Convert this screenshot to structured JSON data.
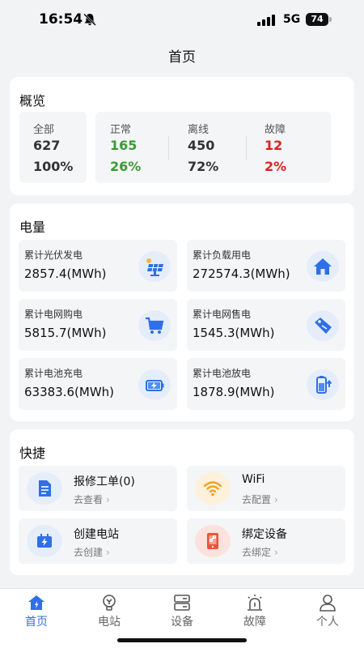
{
  "status_bar": {
    "time": "16:54",
    "network": "5G",
    "battery": "74"
  },
  "page": {
    "title": "首页"
  },
  "overview": {
    "title": "概览",
    "all": {
      "label": "全部",
      "count": "627",
      "percent": "100%"
    },
    "normal": {
      "label": "正常",
      "count": "165",
      "percent": "26%",
      "color": "#3a9a35"
    },
    "offline": {
      "label": "离线",
      "count": "450",
      "percent": "72%",
      "color": "#333333"
    },
    "fault": {
      "label": "故障",
      "count": "12",
      "percent": "2%",
      "color": "#e02020"
    }
  },
  "energy": {
    "title": "电量",
    "items": [
      {
        "label": "累计光伏发电",
        "value": "2857.4(MWh)",
        "icon": "solar-panel-icon"
      },
      {
        "label": "累计负载用电",
        "value": "272574.3(MWh)",
        "icon": "home-icon"
      },
      {
        "label": "累计电网购电",
        "value": "5815.7(MWh)",
        "icon": "cart-icon"
      },
      {
        "label": "累计电网售电",
        "value": "1545.3(MWh)",
        "icon": "price-tag-icon"
      },
      {
        "label": "累计电池充电",
        "value": "63383.6(MWh)",
        "icon": "battery-charge-icon"
      },
      {
        "label": "累计电池放电",
        "value": "1878.9(MWh)",
        "icon": "battery-discharge-icon"
      }
    ]
  },
  "quick": {
    "title": "快捷",
    "items": [
      {
        "label": "报修工单(0)",
        "action": "去查看",
        "icon": "document-icon",
        "color": "#2f6fe8"
      },
      {
        "label": "WiFi",
        "action": "去配置",
        "icon": "wifi-icon",
        "color": "#f0a020"
      },
      {
        "label": "创建电站",
        "action": "去创建",
        "icon": "power-station-icon",
        "color": "#2f6fe8"
      },
      {
        "label": "绑定设备",
        "action": "去绑定",
        "icon": "bind-device-icon",
        "color": "#e8553a"
      }
    ]
  },
  "tabs": [
    {
      "label": "首页",
      "icon": "home-tab-icon",
      "active": true
    },
    {
      "label": "电站",
      "icon": "station-tab-icon"
    },
    {
      "label": "设备",
      "icon": "device-tab-icon"
    },
    {
      "label": "故障",
      "icon": "fault-tab-icon"
    },
    {
      "label": "个人",
      "icon": "person-tab-icon"
    }
  ],
  "colors": {
    "accent": "#2f6fe8",
    "background": "#f2f3f5",
    "icon_bg": "#e5edfb"
  }
}
